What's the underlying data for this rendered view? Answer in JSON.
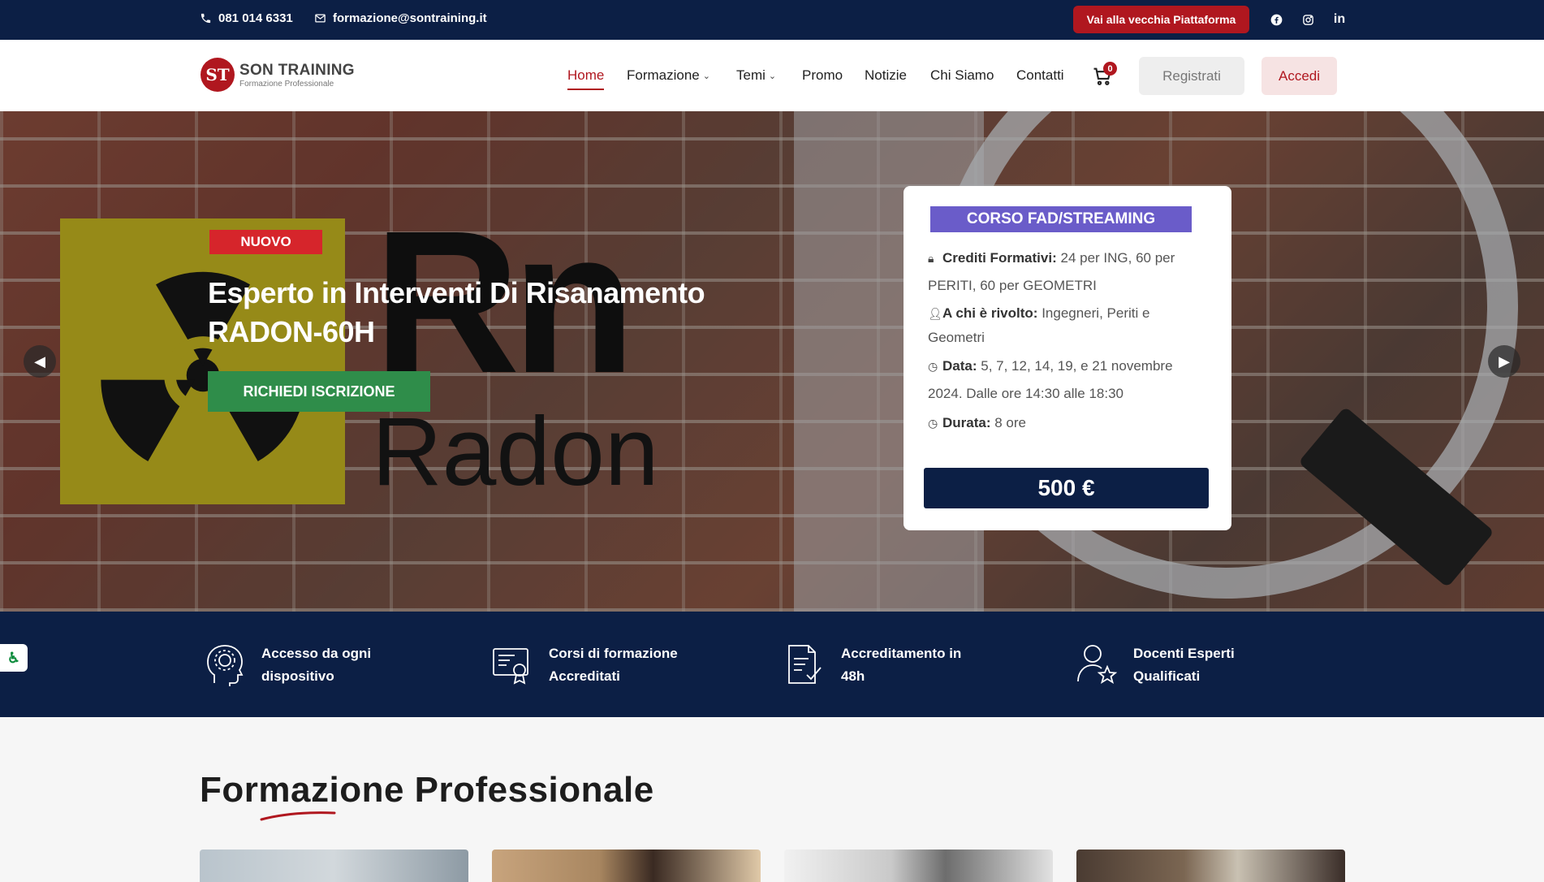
{
  "topbar": {
    "phone": "081 014 6331",
    "email": "formazione@sontraining.it",
    "old_platform_label": "Vai alla vecchia Piattaforma",
    "social": [
      "facebook-icon",
      "instagram-icon",
      "linkedin-icon"
    ]
  },
  "header": {
    "logo_title": "SON TRAINING",
    "logo_subtitle": "Formazione Professionale",
    "nav": [
      {
        "label": "Home",
        "active": true
      },
      {
        "label": "Formazione",
        "dropdown": true
      },
      {
        "label": "Temi",
        "dropdown": true
      },
      {
        "label": "Promo"
      },
      {
        "label": "Notizie"
      },
      {
        "label": "Chi Siamo"
      },
      {
        "label": "Contatti"
      }
    ],
    "cart_count": "0",
    "register_label": "Registrati",
    "login_label": "Accedi"
  },
  "hero": {
    "badge": "NUOVO",
    "title": "Esperto in Interventi Di Risanamento RADON-60H",
    "cta_label": "RICHIEDI ISCRIZIONE",
    "image_text_rn": "Rn",
    "image_text_radon": "Radon",
    "card": {
      "badge": "CORSO FAD/STREAMING",
      "credits_label": "Crediti Formativi:",
      "credits_value": "24 per ING, 60 per PERITI, 60 per GEOMETRI",
      "audience_label": "A chi è rivolto:",
      "audience_value": "Ingegneri, Periti e Geometri",
      "date_label": "Data:",
      "date_value": "5, 7, 12, 14, 19, e 21 novembre 2024. Dalle ore 14:30 alle 18:30",
      "duration_label": "Durata:",
      "duration_value": "8 ore",
      "price": "500 €"
    }
  },
  "features": [
    {
      "icon": "head-gear-icon",
      "line1": "Accesso da ogni",
      "line2": "dispositivo"
    },
    {
      "icon": "certificate-icon",
      "line1": "Corsi di formazione",
      "line2": "Accreditati"
    },
    {
      "icon": "document-check-icon",
      "line1": "Accreditamento in",
      "line2": "48h"
    },
    {
      "icon": "user-star-icon",
      "line1": "Docenti Esperti",
      "line2": "Qualificati"
    }
  ],
  "section": {
    "title": "Formazione Professionale"
  },
  "colors": {
    "navy": "#0c1f45",
    "brand_red": "#b0171f",
    "cta_green": "#2f8d4a",
    "card_badge_purple": "#6a5cc9"
  }
}
